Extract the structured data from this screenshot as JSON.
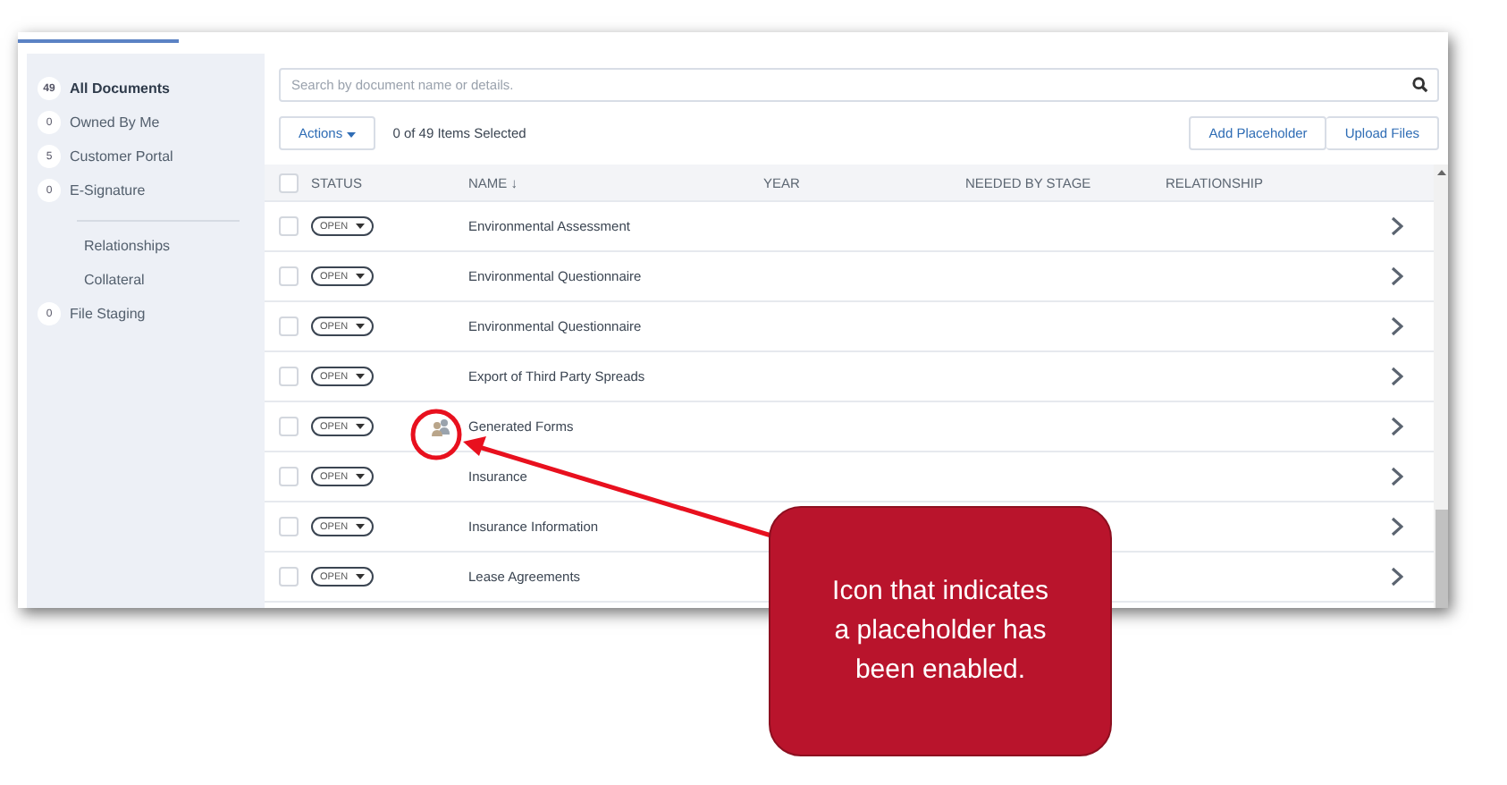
{
  "sidebar": {
    "groups": [
      {
        "items": [
          {
            "count": "49",
            "label": "All Documents",
            "selected": true
          },
          {
            "count": "0",
            "label": "Owned By Me",
            "selected": false
          },
          {
            "count": "5",
            "label": "Customer Portal",
            "selected": false
          },
          {
            "count": "0",
            "label": "E-Signature",
            "selected": false
          }
        ]
      },
      {
        "items": [
          {
            "label": "Relationships",
            "selected": false
          },
          {
            "label": "Collateral",
            "selected": false
          },
          {
            "count": "0",
            "label": "File Staging",
            "selected": false
          }
        ]
      }
    ]
  },
  "search": {
    "placeholder": "Search by document name or details."
  },
  "toolbar": {
    "actions": "Actions",
    "selection": "0 of 49 Items Selected",
    "buttons": [
      "Add Placeholder",
      "Upload Files"
    ]
  },
  "table": {
    "columns": [
      "STATUS",
      "NAME",
      "YEAR",
      "NEEDED BY STAGE",
      "RELATIONSHIP"
    ],
    "sort_mark": "↓",
    "all_checked": false,
    "rows": [
      {
        "checked": false,
        "status": "OPEN",
        "placeholder": false,
        "name": "Environmental Assessment"
      },
      {
        "checked": false,
        "status": "OPEN",
        "placeholder": false,
        "name": "Environmental Questionnaire"
      },
      {
        "checked": false,
        "status": "OPEN",
        "placeholder": false,
        "name": "Environmental Questionnaire"
      },
      {
        "checked": false,
        "status": "OPEN",
        "placeholder": false,
        "name": "Export of Third Party Spreads"
      },
      {
        "checked": false,
        "status": "OPEN",
        "placeholder": true,
        "name": "Generated Forms"
      },
      {
        "checked": false,
        "status": "OPEN",
        "placeholder": false,
        "name": "Insurance"
      },
      {
        "checked": false,
        "status": "OPEN",
        "placeholder": false,
        "name": "Insurance Information"
      },
      {
        "checked": false,
        "status": "OPEN",
        "placeholder": false,
        "name": "Lease Agreements"
      }
    ]
  },
  "callout": {
    "text": "Icon that indicates a placeholder has been enabled."
  }
}
